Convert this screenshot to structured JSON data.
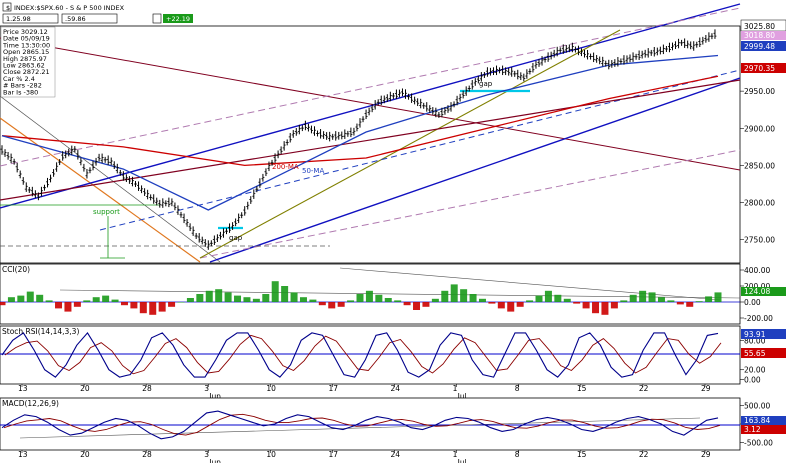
{
  "header": {
    "prefix": "$",
    "title": "INDEX:$SPX.60 - S & P 500 INDEX",
    "field_a": "1.25.98",
    "field_b": ".59.86",
    "field_c": "+22.19"
  },
  "info_box": {
    "lines": [
      "Price    3029.12",
      "Date    05/09/19",
      "Time    13:30:00",
      "Open   2865.15",
      "High    2875.97",
      "Low     2863.62",
      "Close   2872.21",
      "Car %   2.4",
      "# Bars  -282",
      "Bar Is  -380"
    ]
  },
  "colors": {
    "price_bar": "#000000",
    "ma200": "#cc0000",
    "ma50": "#1f3fbf",
    "channel_blue": "#1010c0",
    "channel_dashed": "#b07ab0",
    "maroon_line": "#800020",
    "olive_line": "#808000",
    "orange_line": "#e07820",
    "cci_pos": "#1a9a1a",
    "cci_neg": "#cc0000",
    "rsi_line": "#00008b",
    "rsi_signal": "#8b0000",
    "macd_line": "#00008b",
    "macd_signal": "#8b0000",
    "ref_line": "#0000cc",
    "cyan": "#00c8e8",
    "label_box_blue": "#1f3fbf",
    "label_box_red": "#cc0000",
    "label_box_magenta": "#e0a0e0"
  },
  "annotations": {
    "support": "support",
    "gap1": "gap",
    "gap2": "gap",
    "ma200_label": "200-MA",
    "ma50_label": "50-MA"
  },
  "price_axis": {
    "ticks": [
      "2950.00",
      "2900.00",
      "2850.00",
      "2800.00",
      "2750.00"
    ],
    "badges": [
      "3025.80",
      "3018.80",
      "2999.48",
      "2970.35"
    ]
  },
  "cci_panel": {
    "title": "CCI(20)",
    "ticks": [
      "400.00",
      "200.00",
      "0.00",
      "-200.00"
    ],
    "badge": "124.08"
  },
  "rsi_panel": {
    "title": "Stoch RSI(14,14,3,3)",
    "ticks": [
      "80.00",
      "20.00",
      "0.00"
    ],
    "badges": [
      "93.91",
      "55.65"
    ]
  },
  "macd_panel": {
    "title": "MACD(12,26,9)",
    "ticks": [
      "500.00",
      "0.00",
      "-500.00"
    ],
    "badges": [
      "163.84",
      "3.12"
    ]
  },
  "time_axis": {
    "labels": [
      "13",
      "20",
      "28",
      "3",
      "10",
      "17",
      "24",
      "1",
      "8",
      "15",
      "22",
      "29"
    ],
    "months": [
      "Jun",
      "Jul"
    ]
  },
  "chart_data": {
    "type": "line",
    "title": "INDEX:$SPX.60 - S & P 500 INDEX",
    "series": [],
    "xlabels": [
      "13",
      "20",
      "28",
      "3",
      "10",
      "17",
      "24",
      "1",
      "8",
      "15",
      "22",
      "29"
    ],
    "x_months": [
      "Jun",
      "Jul"
    ],
    "price_ylim": [
      2720,
      3035
    ],
    "price_ticks": [
      2950,
      2900,
      2850,
      2800,
      2750
    ],
    "price_badges": [
      3025.8,
      3018.8,
      2999.48,
      2970.35
    ],
    "price_path": [
      [
        0,
        2870
      ],
      [
        2,
        2855
      ],
      [
        4,
        2820
      ],
      [
        6,
        2808
      ],
      [
        8,
        2832
      ],
      [
        10,
        2862
      ],
      [
        12,
        2872
      ],
      [
        14,
        2838
      ],
      [
        16,
        2860
      ],
      [
        18,
        2855
      ],
      [
        20,
        2835
      ],
      [
        22,
        2825
      ],
      [
        24,
        2810
      ],
      [
        26,
        2798
      ],
      [
        28,
        2800
      ],
      [
        30,
        2778
      ],
      [
        32,
        2755
      ],
      [
        34,
        2742
      ],
      [
        36,
        2755
      ],
      [
        38,
        2768
      ],
      [
        40,
        2788
      ],
      [
        42,
        2818
      ],
      [
        44,
        2848
      ],
      [
        46,
        2870
      ],
      [
        48,
        2892
      ],
      [
        50,
        2903
      ],
      [
        52,
        2893
      ],
      [
        54,
        2888
      ],
      [
        56,
        2890
      ],
      [
        58,
        2895
      ],
      [
        60,
        2918
      ],
      [
        62,
        2935
      ],
      [
        64,
        2942
      ],
      [
        66,
        2948
      ],
      [
        68,
        2937
      ],
      [
        70,
        2928
      ],
      [
        72,
        2918
      ],
      [
        74,
        2928
      ],
      [
        76,
        2945
      ],
      [
        78,
        2962
      ],
      [
        80,
        2975
      ],
      [
        82,
        2978
      ],
      [
        84,
        2975
      ],
      [
        86,
        2968
      ],
      [
        88,
        2985
      ],
      [
        90,
        2995
      ],
      [
        92,
        3005
      ],
      [
        94,
        3008
      ],
      [
        96,
        3000
      ],
      [
        98,
        2993
      ],
      [
        100,
        2985
      ],
      [
        102,
        2990
      ],
      [
        104,
        2995
      ],
      [
        106,
        3000
      ],
      [
        108,
        3003
      ],
      [
        110,
        3008
      ],
      [
        112,
        3015
      ],
      [
        114,
        3010
      ],
      [
        116,
        3020
      ],
      [
        118,
        3028
      ]
    ],
    "ma200_path": [
      [
        0,
        2890
      ],
      [
        20,
        2875
      ],
      [
        40,
        2850
      ],
      [
        60,
        2860
      ],
      [
        80,
        2900
      ],
      [
        100,
        2940
      ],
      [
        118,
        2970
      ]
    ],
    "ma50_path": [
      [
        0,
        2890
      ],
      [
        20,
        2845
      ],
      [
        34,
        2790
      ],
      [
        44,
        2830
      ],
      [
        60,
        2895
      ],
      [
        80,
        2945
      ],
      [
        100,
        2985
      ],
      [
        118,
        2998
      ]
    ],
    "cci_ylim": [
      -250,
      450
    ],
    "cci_ticks": [
      400,
      200,
      0,
      -200
    ],
    "cci_badge": 124.08,
    "cci_values": [
      -40,
      60,
      80,
      130,
      90,
      20,
      -80,
      -120,
      -60,
      20,
      60,
      80,
      30,
      -40,
      -80,
      -140,
      -160,
      -120,
      -60,
      0,
      50,
      100,
      140,
      160,
      120,
      80,
      60,
      40,
      100,
      260,
      200,
      120,
      60,
      30,
      -40,
      -80,
      -60,
      20,
      100,
      140,
      90,
      50,
      20,
      -40,
      -100,
      -60,
      40,
      140,
      220,
      160,
      100,
      40,
      -20,
      -80,
      -120,
      -60,
      20,
      80,
      140,
      90,
      40,
      -20,
      -80,
      -140,
      -160,
      -80,
      20,
      90,
      140,
      120,
      60,
      20,
      -30,
      -60,
      10,
      70,
      120
    ],
    "rsi_ylim": [
      -5,
      105
    ],
    "rsi_ticks": [
      80,
      20,
      0
    ],
    "rsi_badges": [
      93.91,
      55.65
    ],
    "rsi_values": [
      50,
      80,
      95,
      60,
      20,
      5,
      30,
      70,
      95,
      60,
      20,
      5,
      10,
      40,
      85,
      95,
      70,
      30,
      5,
      5,
      40,
      80,
      95,
      95,
      60,
      20,
      5,
      30,
      80,
      95,
      90,
      50,
      10,
      5,
      40,
      90,
      95,
      60,
      15,
      5,
      20,
      70,
      95,
      90,
      40,
      10,
      5,
      50,
      95,
      95,
      60,
      20,
      5,
      30,
      85,
      95,
      70,
      25,
      5,
      10,
      60,
      95,
      95,
      50,
      10,
      40,
      90,
      94
    ],
    "macd_ylim": [
      -650,
      650
    ],
    "macd_ticks": [
      500,
      0,
      -500
    ],
    "macd_badges": [
      163.84,
      3.12
    ],
    "macd_values": [
      -100,
      100,
      250,
      200,
      50,
      -150,
      -300,
      -250,
      -100,
      50,
      150,
      100,
      -50,
      -250,
      -400,
      -350,
      -200,
      50,
      300,
      350,
      250,
      150,
      50,
      -50,
      0,
      150,
      250,
      200,
      50,
      -100,
      -150,
      -50,
      100,
      200,
      150,
      50,
      -100,
      -150,
      -50,
      100,
      180,
      150,
      50,
      -100,
      -200,
      -150,
      0,
      120,
      180,
      120,
      0,
      -150,
      -200,
      -100,
      50,
      150,
      200,
      120,
      0,
      -200,
      -300,
      -100,
      100,
      164
    ]
  }
}
